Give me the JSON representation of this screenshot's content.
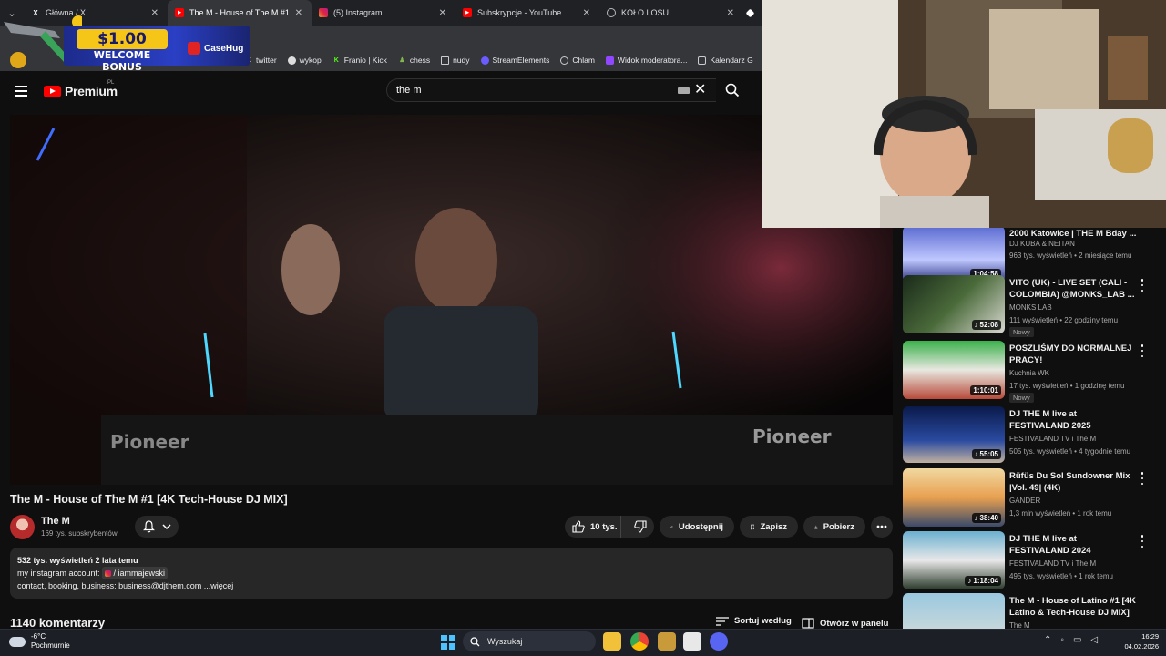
{
  "browser": {
    "tabs": [
      {
        "label": "Główna / X",
        "icon": "x-icon",
        "active": false
      },
      {
        "label": "The M - House of The M #1 [4K",
        "icon": "youtube-icon",
        "active": true
      },
      {
        "label": "(5) Instagram",
        "icon": "instagram-icon",
        "active": false
      },
      {
        "label": "Subskrypcje - YouTube",
        "icon": "youtube-icon",
        "active": false
      },
      {
        "label": "KOŁO LOSU",
        "icon": "globe-icon",
        "active": false
      }
    ],
    "bookmarks": [
      "twitter",
      "wykop",
      "Franio | Kick",
      "chess",
      "nudy",
      "StreamElements",
      "Chlam",
      "Widok moderatora...",
      "Kalendarz G"
    ]
  },
  "ad": {
    "amount": "$1.00",
    "text": "WELCOME BONUS",
    "brand": "CaseHug"
  },
  "youtube": {
    "brand": "Premium",
    "region": "PL",
    "search_value": "the m"
  },
  "video": {
    "title": "The M - House of The M #1 [4K Tech-House DJ MIX]",
    "channel": "The M",
    "subscribers": "169 tys. subskrybentów",
    "likes": "10 tys.",
    "share_label": "Udostępnij",
    "save_label": "Zapisz",
    "download_label": "Pobierz",
    "description": {
      "views_line": "532 tys. wyświetleń  2 lata temu",
      "line2_prefix": "my instagram account: ",
      "line2_handle": " / iammajewski",
      "line3": "contact, booking, business: business@djthem.com ...więcej"
    },
    "comments": "1140 komentarzy",
    "sort_label": "Sortuj według",
    "open_panel_label": "Otwórz w panelu"
  },
  "recommendations": [
    {
      "title": "2000 Katowice | THE M Bday ...",
      "channel": "DJ KUBA & NEITAN",
      "meta": "963 tys. wyświetleń • 2 miesiące temu",
      "duration": "1:04:58",
      "badge": "",
      "music": false
    },
    {
      "title": "VITO (UK) - LIVE SET (CALI - COLOMBIA) @MONKS_LAB ...",
      "channel": "MONKS LAB",
      "meta": "111 wyświetleń • 22 godziny temu",
      "duration": "52:08",
      "badge": "Nowy",
      "music": true
    },
    {
      "title": "POSZLIŚMY DO NORMALNEJ PRACY!",
      "channel": "Kuchnia WK",
      "meta": "17 tys. wyświetleń • 1 godzinę temu",
      "duration": "1:10:01",
      "badge": "Nowy",
      "music": false
    },
    {
      "title": "DJ THE M live at FESTIVALAND 2025",
      "channel": "FESTIVALAND TV i The M",
      "meta": "505 tys. wyświetleń • 4 tygodnie temu",
      "duration": "55:05",
      "badge": "",
      "music": true
    },
    {
      "title": "Rüfüs Du Sol Sundowner Mix |Vol. 49| (4K)",
      "channel": "GANDER",
      "meta": "1,3 mln wyświetleń • 1 rok temu",
      "duration": "38:40",
      "badge": "",
      "music": true
    },
    {
      "title": "DJ THE M live at FESTIVALAND 2024",
      "channel": "FESTIVALAND TV i The M",
      "meta": "495 tys. wyświetleń • 1 rok temu",
      "duration": "1:18:04",
      "badge": "",
      "music": true
    },
    {
      "title": "The M - House of Latino #1 [4K Latino & Tech-House DJ MIX]",
      "channel": "The M",
      "meta": "",
      "duration": "",
      "badge": "",
      "music": false
    }
  ],
  "taskbar": {
    "temperature": "-6°C",
    "weather": "Pochmurnie",
    "search_label": "Wyszukaj",
    "time": "16:29",
    "date": "04.02.2026"
  },
  "colors": {
    "yt_red": "#ff0000",
    "bg": "#0f0f0f",
    "pill": "#272727",
    "accent": "#4cc2ff"
  }
}
